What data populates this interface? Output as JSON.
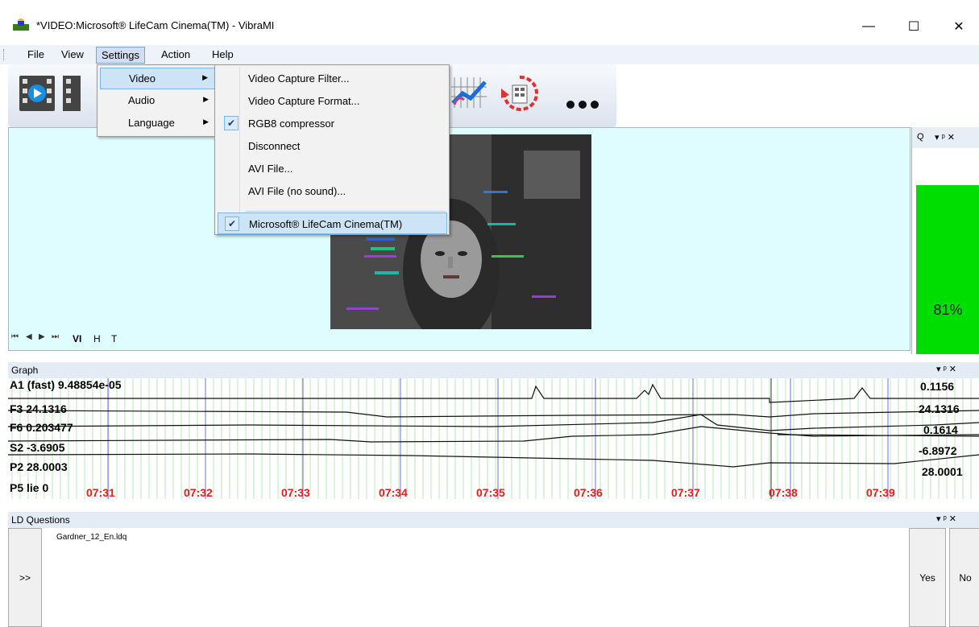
{
  "window": {
    "title": "*VIDEO:Microsoft® LifeCam Cinema(TM) - VibraMI",
    "minimize": "—",
    "maximize": "☐",
    "close": "✕"
  },
  "menubar": {
    "items": [
      "File",
      "View",
      "Settings",
      "Action",
      "Help"
    ]
  },
  "settings_menu": {
    "items": [
      "Video",
      "Audio",
      "Language"
    ]
  },
  "video_menu": {
    "items": [
      {
        "label": "Video Capture Filter...",
        "checked": false
      },
      {
        "label": "Video Capture Format...",
        "checked": false
      },
      {
        "label": "RGB8 compressor",
        "checked": true
      },
      {
        "label": "Disconnect",
        "checked": false
      },
      {
        "label": "AVI File...",
        "checked": false
      },
      {
        "label": "AVI File (no sound)...",
        "checked": false
      },
      {
        "label": "Microsoft® LifeCam Cinema(TM)",
        "checked": true
      }
    ]
  },
  "tabs": {
    "items": [
      "VI",
      "H",
      "T"
    ]
  },
  "q_panel": {
    "title": "Q",
    "value": "81%",
    "level": 0.81
  },
  "graph": {
    "title": "Graph",
    "left_labels": [
      "A1 (fast) 9.48854e-05",
      "F3 24.1316",
      "F6 0.203477",
      "S2 -3.6905",
      "P2 28.0003",
      "P5 lie 0"
    ],
    "right_labels": [
      "0.1156",
      "24.1316",
      "0.1614",
      "-6.8972",
      "28.0001"
    ],
    "time_ticks": [
      "07:31",
      "07:32",
      "07:33",
      "07:34",
      "07:35",
      "07:36",
      "07:37",
      "07:38",
      "07:39"
    ]
  },
  "ld_questions": {
    "title": "LD Questions",
    "file": "Gardner_12_En.ldq",
    "next_label": ">>",
    "yes_label": "Yes",
    "no_label": "No"
  },
  "panel_controls": "▾ ᵖ ✕"
}
